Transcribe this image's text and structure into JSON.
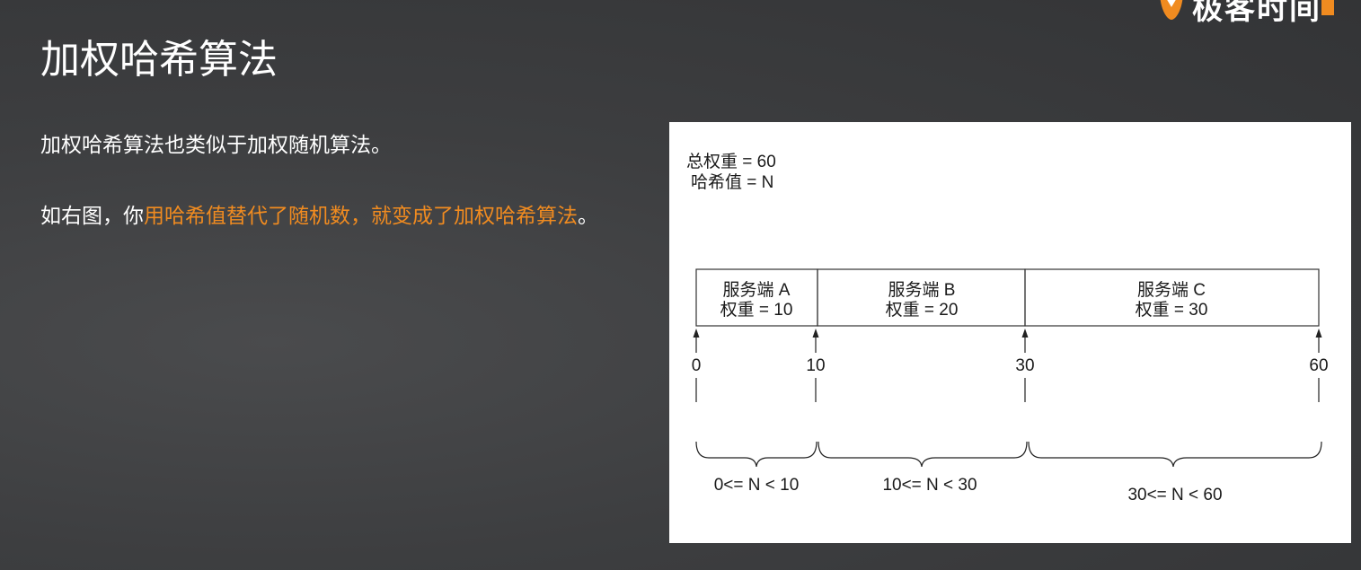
{
  "brand": {
    "name": "极客时间",
    "accent": "#f08b20"
  },
  "title": "加权哈希算法",
  "paragraph1": "加权哈希算法也类似于加权随机算法。",
  "paragraph2": {
    "prefix": "如右图，你",
    "highlight": "用哈希值替代了随机数，就变成了加权哈希算法",
    "suffix": "。"
  },
  "diagram": {
    "summary": [
      "总权重 = 60",
      "哈希值 = N"
    ],
    "servers": [
      {
        "name": "服务端 A",
        "weight": "权重 = 10"
      },
      {
        "name": "服务端 B",
        "weight": "权重 = 20"
      },
      {
        "name": "服务端 C",
        "weight": "权重 = 30"
      }
    ],
    "ticks": [
      "0",
      "10",
      "30",
      "60"
    ],
    "ranges": [
      "0<= N < 10",
      "10<= N < 30",
      "30<= N < 60"
    ]
  }
}
